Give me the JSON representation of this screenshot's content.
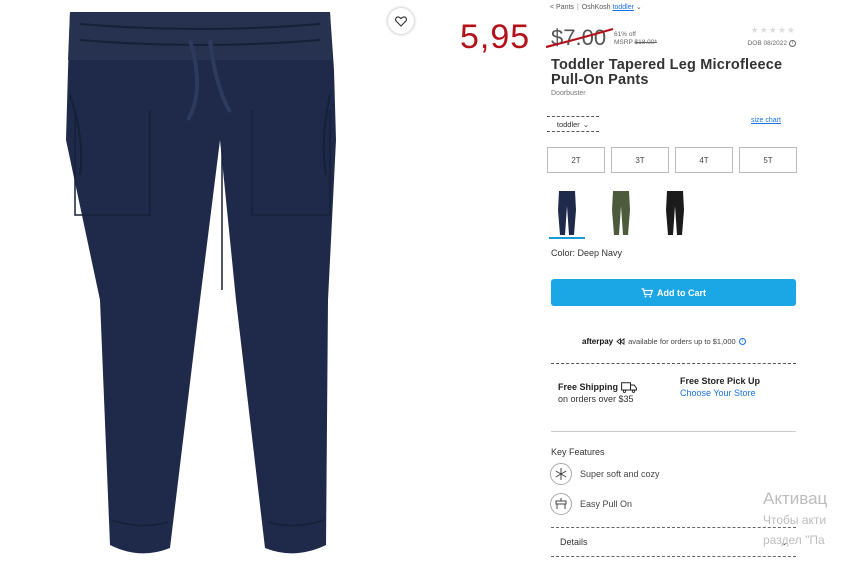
{
  "annotation": {
    "new_price": "5,95"
  },
  "breadcrumb": {
    "back": "< Pants",
    "brand": "OshKosh",
    "category": "toddler"
  },
  "price": {
    "current": "$7.00",
    "discount": "61% off",
    "msrp_label": "MSRP",
    "msrp_value": "$18.00*"
  },
  "rating": {
    "stars": "★★★★★"
  },
  "dob": {
    "text": "DOB 08/2022"
  },
  "product": {
    "title": "Toddler Tapered Leg Microfleece Pull-On Pants",
    "badge": "Doorbuster"
  },
  "size": {
    "type_label": "toddler",
    "chart_link": "size chart",
    "options": [
      "2T",
      "3T",
      "4T",
      "5T"
    ]
  },
  "swatches": [
    {
      "name": "Deep Navy",
      "color": "#1f2a4a",
      "selected": true
    },
    {
      "name": "Olive",
      "color": "#4d5a3c",
      "selected": false
    },
    {
      "name": "Black",
      "color": "#1b1b1b",
      "selected": false
    }
  ],
  "color": {
    "label": "Color: Deep Navy"
  },
  "cart": {
    "label": "Add to Cart",
    "accent": "#1ba6e5"
  },
  "afterpay": {
    "logo": "afterpay",
    "text": "available for orders up to $1,000"
  },
  "shipping": {
    "title": "Free Shipping",
    "subtitle": "on orders over $35"
  },
  "pickup": {
    "title": "Free Store Pick Up",
    "link": "Choose Your Store"
  },
  "features": {
    "heading": "Key Features",
    "items": [
      {
        "label": "Super soft and cozy",
        "icon": "snowflake-icon"
      },
      {
        "label": "Easy Pull On",
        "icon": "pull-on-icon"
      }
    ]
  },
  "details": {
    "label": "Details"
  },
  "watermark": {
    "title": "Активац",
    "line1": "Чтобы акти",
    "line2": "раздел \"Па"
  }
}
